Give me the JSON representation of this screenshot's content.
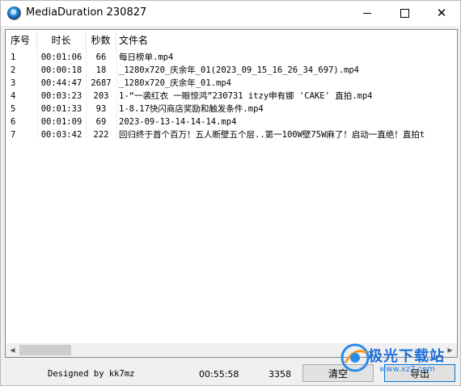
{
  "window": {
    "title": "MediaDuration 230827",
    "min_glyph": "",
    "max_glyph": "",
    "close_glyph": "✕"
  },
  "table": {
    "headers": {
      "idx": "序号",
      "duration": "时长",
      "seconds": "秒数",
      "filename": "文件名"
    },
    "rows": [
      {
        "idx": "1",
        "duration": "00:01:06",
        "seconds": "66",
        "filename": "每日榜单.mp4"
      },
      {
        "idx": "2",
        "duration": "00:00:18",
        "seconds": "18",
        "filename": "_1280x720_庆余年_01(2023_09_15_16_26_34_697).mp4"
      },
      {
        "idx": "3",
        "duration": "00:44:47",
        "seconds": "2687",
        "filename": "_1280x720_庆余年_01.mp4"
      },
      {
        "idx": "4",
        "duration": "00:03:23",
        "seconds": "203",
        "filename": "1-“一袭红衣 一眼惊鸿”230731 itzy申有娜 'CAKE' 直拍.mp4"
      },
      {
        "idx": "5",
        "duration": "00:01:33",
        "seconds": "93",
        "filename": "1-8.17快闪商店奖励和触发条件.mp4"
      },
      {
        "idx": "6",
        "duration": "00:01:09",
        "seconds": "69",
        "filename": "2023-09-13-14-14-14.mp4"
      },
      {
        "idx": "7",
        "duration": "00:03:42",
        "seconds": "222",
        "filename": "回归终于首个百万！五人断壁五个层..第一100W壁75W麻了！启动一直绝！直拍t"
      }
    ]
  },
  "status": {
    "designed_by": "Designed by kk7mz",
    "total_duration": "00:55:58",
    "total_seconds": "3358",
    "clear_label": "清空",
    "export_label": "导出"
  },
  "watermark": {
    "text": "极光下载站",
    "url": "www.xz7.com"
  },
  "colors": {
    "accent": "#0078d7",
    "watermark": "#1e6fd9"
  }
}
